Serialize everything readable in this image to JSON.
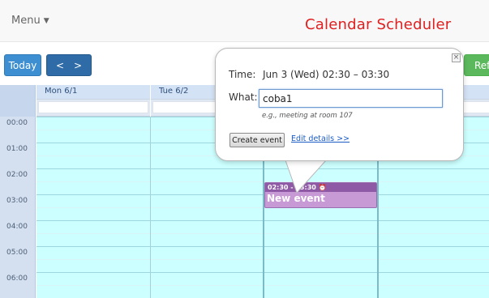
{
  "header": {
    "menu_label": "Menu",
    "app_title": "Calendar Scheduler"
  },
  "toolbar": {
    "today_label": "Today",
    "prev_label": "<",
    "next_label": ">",
    "refresh_label": "Refr"
  },
  "calendar": {
    "day_headers": [
      "Mon 6/1",
      "Tue 6/2"
    ],
    "time_labels": [
      "00:00",
      "01:00",
      "02:00",
      "03:00",
      "04:00",
      "05:00",
      "06:00"
    ]
  },
  "event": {
    "time_label": "02:30 - 03:30",
    "title": "New event"
  },
  "popup": {
    "time_label": "Time:",
    "time_value": "Jun 3 (Wed) 02:30 – 03:30",
    "what_label": "What:",
    "what_value": "coba1",
    "hint": "e.g., meeting at room 107",
    "create_button": "Create event",
    "edit_details_link": "Edit details >>",
    "close_glyph": "×"
  },
  "colors": {
    "title_red": "#e02020",
    "grid_cyan": "#ccffff",
    "event_purple": "#c79ad5",
    "refresh_green": "#5cb85c"
  }
}
